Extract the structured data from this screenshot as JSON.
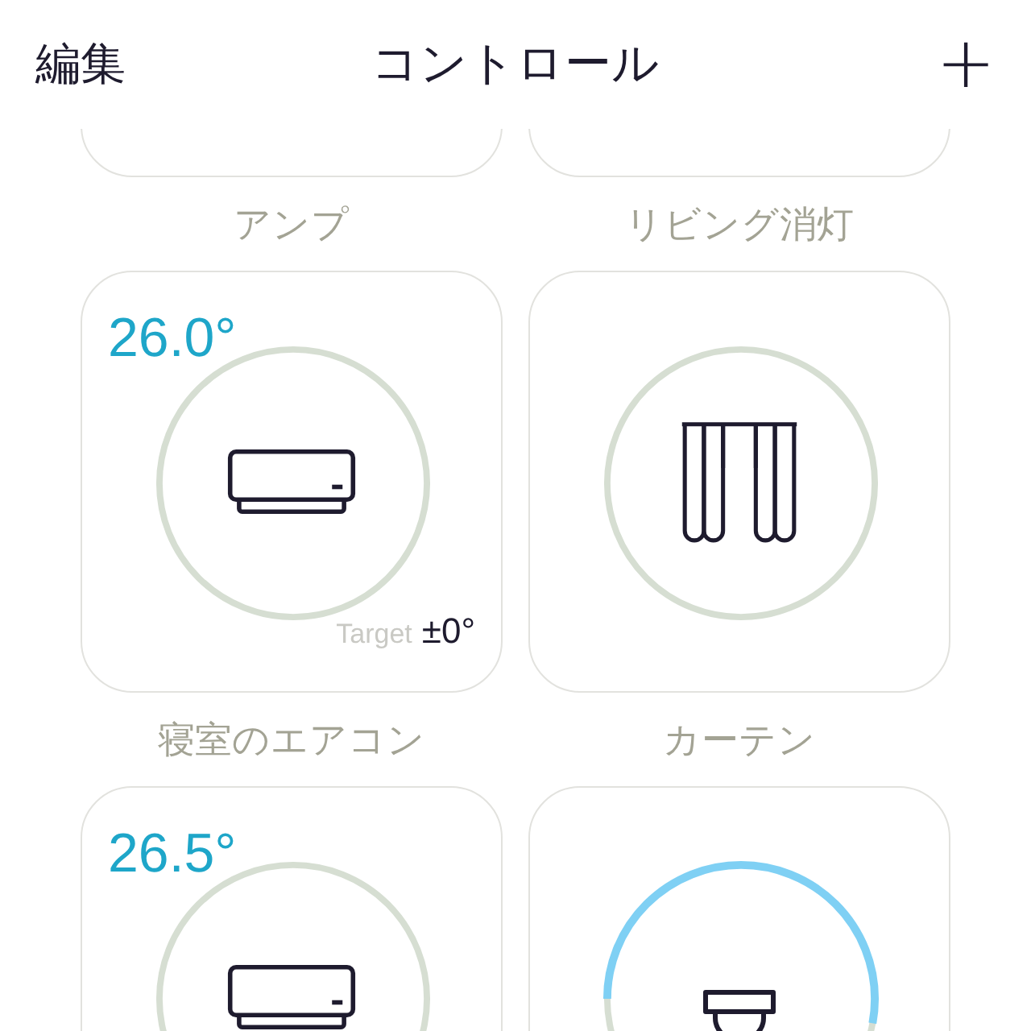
{
  "header": {
    "edit": "編集",
    "title": "コントロール",
    "add": "+"
  },
  "tiles": [
    {
      "name": "アンプ"
    },
    {
      "name": "リビング消灯"
    },
    {
      "name": "寝室のエアコン",
      "kind": "aircon",
      "temperature": "26.0°",
      "target_label": "Target",
      "target_value": "±0°"
    },
    {
      "name": "カーテン",
      "kind": "curtain"
    },
    {
      "kind": "aircon",
      "temperature": "26.5°"
    },
    {
      "kind": "light",
      "level": 0.53
    }
  ]
}
